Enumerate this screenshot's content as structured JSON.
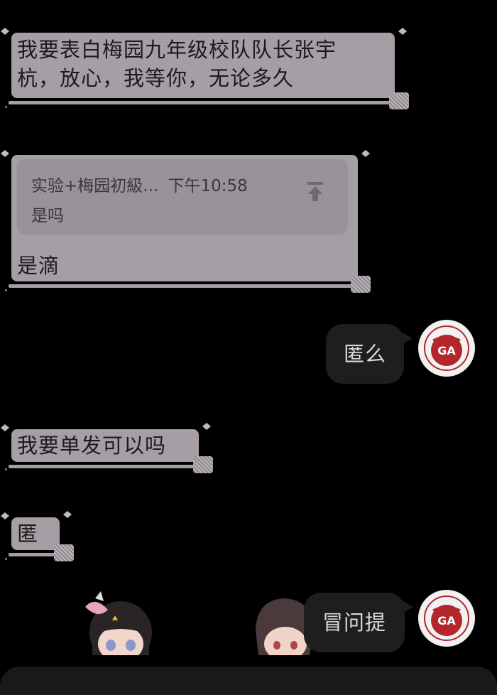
{
  "messages": {
    "m1": {
      "line1": "我要表白梅园九年级校队队长张宇",
      "line2": "杭，放心，我等你，无论多久"
    },
    "m2": {
      "quote_sender": "实验+梅园初級...",
      "quote_time": "下午10:58",
      "quote_text": "是吗",
      "reply": "是滴",
      "quote_icon": "pin-top-icon"
    },
    "m3": {
      "text": "匿么"
    },
    "m4": {
      "text": "我要单发可以吗"
    },
    "m5": {
      "text": "匿"
    },
    "m6": {
      "text": "冒问提"
    }
  },
  "avatar": {
    "emblem_text": "GA"
  },
  "colors": {
    "incoming_bubble": "#a59ea4",
    "outgoing_bubble": "#1e1e1e",
    "background": "#000000",
    "emblem_red": "#b3262b"
  }
}
